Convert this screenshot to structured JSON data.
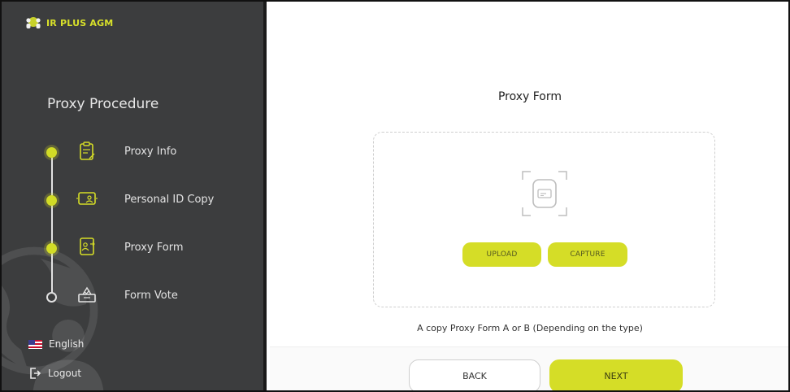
{
  "brand": {
    "name": "IR PLUS AGM",
    "logo_icon": "people-globe-icon"
  },
  "sidebar": {
    "title": "Proxy Procedure",
    "steps": [
      {
        "label": "Proxy Info",
        "icon": "clipboard-icon",
        "status": "done"
      },
      {
        "label": "Personal ID Copy",
        "icon": "id-card-icon",
        "status": "done"
      },
      {
        "label": "Proxy Form",
        "icon": "proxy-form-icon",
        "status": "current"
      },
      {
        "label": "Form Vote",
        "icon": "ballot-box-icon",
        "status": "pending"
      }
    ],
    "language": {
      "label": "English",
      "icon": "us-flag-icon"
    },
    "logout": {
      "label": "Logout",
      "icon": "logout-icon"
    }
  },
  "main": {
    "title": "Proxy Form",
    "upload_label": "UPLOAD",
    "capture_label": "CAPTURE",
    "hint": "A copy Proxy Form A or B (Depending on the type)",
    "back_label": "BACK",
    "next_label": "NEXT"
  },
  "colors": {
    "accent": "#d5dd27",
    "sidebar_bg": "#3c3d3e",
    "brand_text": "#d8e02a"
  }
}
